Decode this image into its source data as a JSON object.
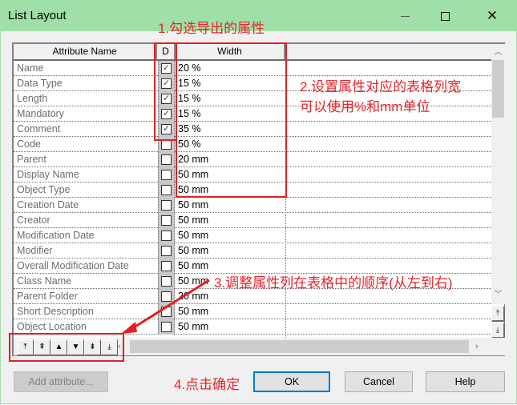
{
  "window": {
    "title": "List Layout",
    "controls": [
      "minimize",
      "maximize",
      "close"
    ]
  },
  "grid": {
    "headers": {
      "name": "Attribute Name",
      "displayed": "D",
      "width": "Width"
    },
    "rows": [
      {
        "name": "Name",
        "checked": true,
        "width": "20 %"
      },
      {
        "name": "Data Type",
        "checked": true,
        "width": "15 %"
      },
      {
        "name": "Length",
        "checked": true,
        "width": "15 %"
      },
      {
        "name": "Mandatory",
        "checked": true,
        "width": "15 %"
      },
      {
        "name": "Comment",
        "checked": true,
        "width": "35 %"
      },
      {
        "name": "Code",
        "checked": false,
        "width": "50 %"
      },
      {
        "name": "Parent",
        "checked": false,
        "width": "20 mm"
      },
      {
        "name": "Display Name",
        "checked": false,
        "width": "50 mm"
      },
      {
        "name": "Object Type",
        "checked": false,
        "width": "50 mm"
      },
      {
        "name": "Creation Date",
        "checked": false,
        "width": "50 mm"
      },
      {
        "name": "Creator",
        "checked": false,
        "width": "50 mm"
      },
      {
        "name": "Modification Date",
        "checked": false,
        "width": "50 mm"
      },
      {
        "name": "Modifier",
        "checked": false,
        "width": "50 mm"
      },
      {
        "name": "Overall Modification Date",
        "checked": false,
        "width": "50 mm"
      },
      {
        "name": "Class Name",
        "checked": false,
        "width": "50 mm"
      },
      {
        "name": "Parent Folder",
        "checked": false,
        "width": "20 mm"
      },
      {
        "name": "Short Description",
        "checked": false,
        "width": "50 mm"
      },
      {
        "name": "Object Location",
        "checked": false,
        "width": "50 mm"
      }
    ],
    "move_buttons": [
      {
        "name": "move-to-top",
        "glyph": "⤒"
      },
      {
        "name": "move-up-page",
        "glyph": "⇞"
      },
      {
        "name": "move-up",
        "glyph": "▲"
      },
      {
        "name": "move-down",
        "glyph": "▼"
      },
      {
        "name": "move-down-page",
        "glyph": "⇟"
      },
      {
        "name": "move-to-bottom",
        "glyph": "⤓"
      }
    ],
    "scroll_glyphs": {
      "up": "︿",
      "down": "﹀",
      "left": "‹",
      "right": "›",
      "top": "⤒",
      "bottom": "⤓"
    }
  },
  "buttons": {
    "add_attribute": "Add attribute...",
    "ok": "OK",
    "cancel": "Cancel",
    "help": "Help"
  },
  "annotations": {
    "step1": "1.勾选导出的属性",
    "step2_line1": "2.设置属性对应的表格列宽",
    "step2_line2": "可以使用%和mm单位",
    "step3": "3.调整属性列在表格中的顺序(从左到右)",
    "step4": "4.点击确定"
  },
  "colors": {
    "titlebar": "#a0dfa8",
    "annotation_red": "#e8242b",
    "ok_border": "#0078d7"
  }
}
